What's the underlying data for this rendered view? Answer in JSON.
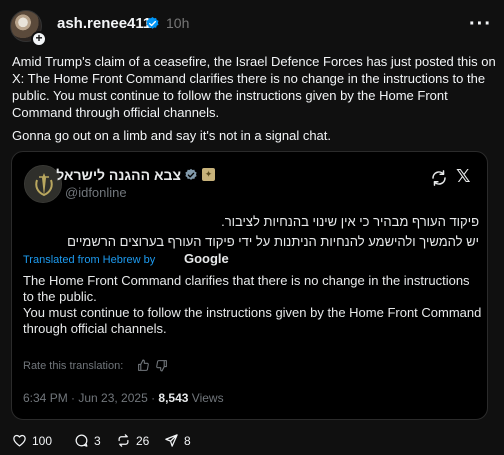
{
  "post": {
    "username": "ash.renee411",
    "time": "10h",
    "body": "Amid Trump's claim of a ceasefire, the Israel Defence Forces has just posted this on X: The Home Front Command clarifies there is no change in the instructions to the public. You must continue to follow the instructions given by the Home Front Command through official channels.",
    "body2": "Gonna go out on a limb and say it's not in a signal chat."
  },
  "embed": {
    "name": "צבא ההגנה לישראל",
    "handle": "@idfonline",
    "hebrew_line1": "פיקוד העורף מבהיר כי אין שינוי בהנחיות לציבור.",
    "hebrew_line2": "יש להמשיך ולהישמע להנחיות הניתנות על ידי פיקוד העורף בערוצים הרשמיים",
    "translated_label": "Translated from Hebrew by",
    "translator": "Google",
    "translation_line1": "The Home Front Command clarifies that there is no change in the instructions to the public.",
    "translation_line2": "You must continue to follow the instructions given by the Home Front Command through official channels.",
    "rate_label": "Rate this translation:",
    "timestamp": "6:34 PM · Jun 23, 2025 · ",
    "views_count": "8,543",
    "views_label": " Views"
  },
  "actions": {
    "likes": "100",
    "replies": "3",
    "reposts": "26",
    "shares": "8"
  },
  "icons": {
    "verified": "verified-badge-icon",
    "more": "more-icon",
    "like": "heart-icon",
    "reply": "comment-icon",
    "repost": "repost-icon",
    "share": "send-icon"
  },
  "colors": {
    "background": "#101010",
    "link": "#1d9bf0",
    "muted": "#777777"
  }
}
